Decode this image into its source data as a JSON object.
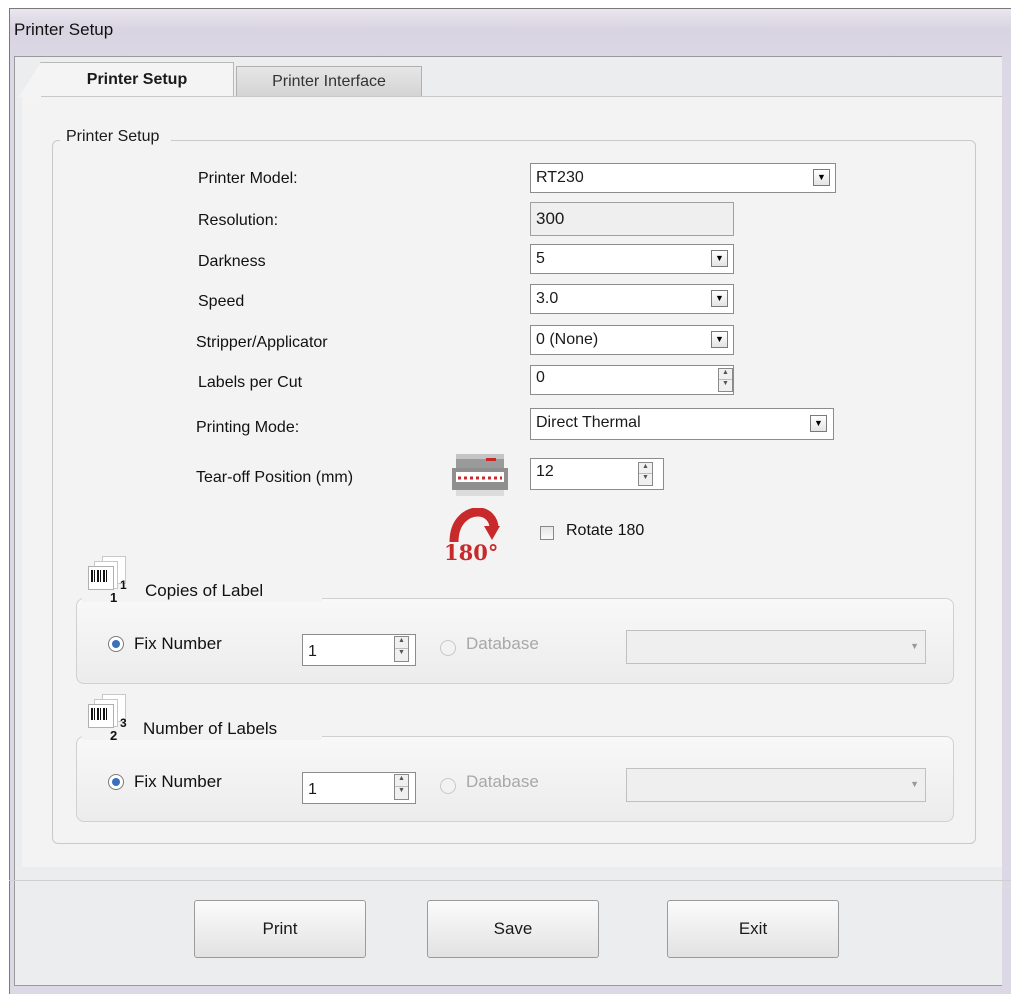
{
  "window": {
    "title": "Printer Setup"
  },
  "tabs": [
    {
      "label": "Printer Setup",
      "active": true
    },
    {
      "label": "Printer Interface",
      "active": false
    }
  ],
  "group": {
    "title": "Printer Setup"
  },
  "fields": {
    "printer_model": {
      "label": "Printer Model:",
      "value": "RT230"
    },
    "resolution": {
      "label": "Resolution:",
      "value": "300"
    },
    "darkness": {
      "label": "Darkness",
      "value": "5"
    },
    "speed": {
      "label": "Speed",
      "value": "3.0"
    },
    "stripper": {
      "label": "Stripper/Applicator",
      "value": "0 (None)"
    },
    "labels_per_cut": {
      "label": "Labels per Cut",
      "value": "0"
    },
    "printing_mode": {
      "label": "Printing Mode:",
      "value": "Direct Thermal"
    },
    "tear_off": {
      "label": "Tear-off Position  (mm)",
      "value": "12"
    },
    "rotate": {
      "label": "Rotate 180",
      "checked": false,
      "icon_text": "180°"
    }
  },
  "copies": {
    "title": "Copies of Label",
    "icon_sub": "1",
    "icon_sup": "1",
    "fix_label": "Fix Number",
    "fix_value": "1",
    "db_label": "Database",
    "mode": "fix"
  },
  "labels": {
    "title": "Number of Labels",
    "icon_sub": "2",
    "icon_sup": "3",
    "fix_label": "Fix Number",
    "fix_value": "1",
    "db_label": "Database",
    "mode": "fix"
  },
  "buttons": {
    "print": "Print",
    "save": "Save",
    "exit": "Exit"
  },
  "colors": {
    "accent_red": "#c8292a",
    "radio_blue": "#3b6fbf"
  }
}
